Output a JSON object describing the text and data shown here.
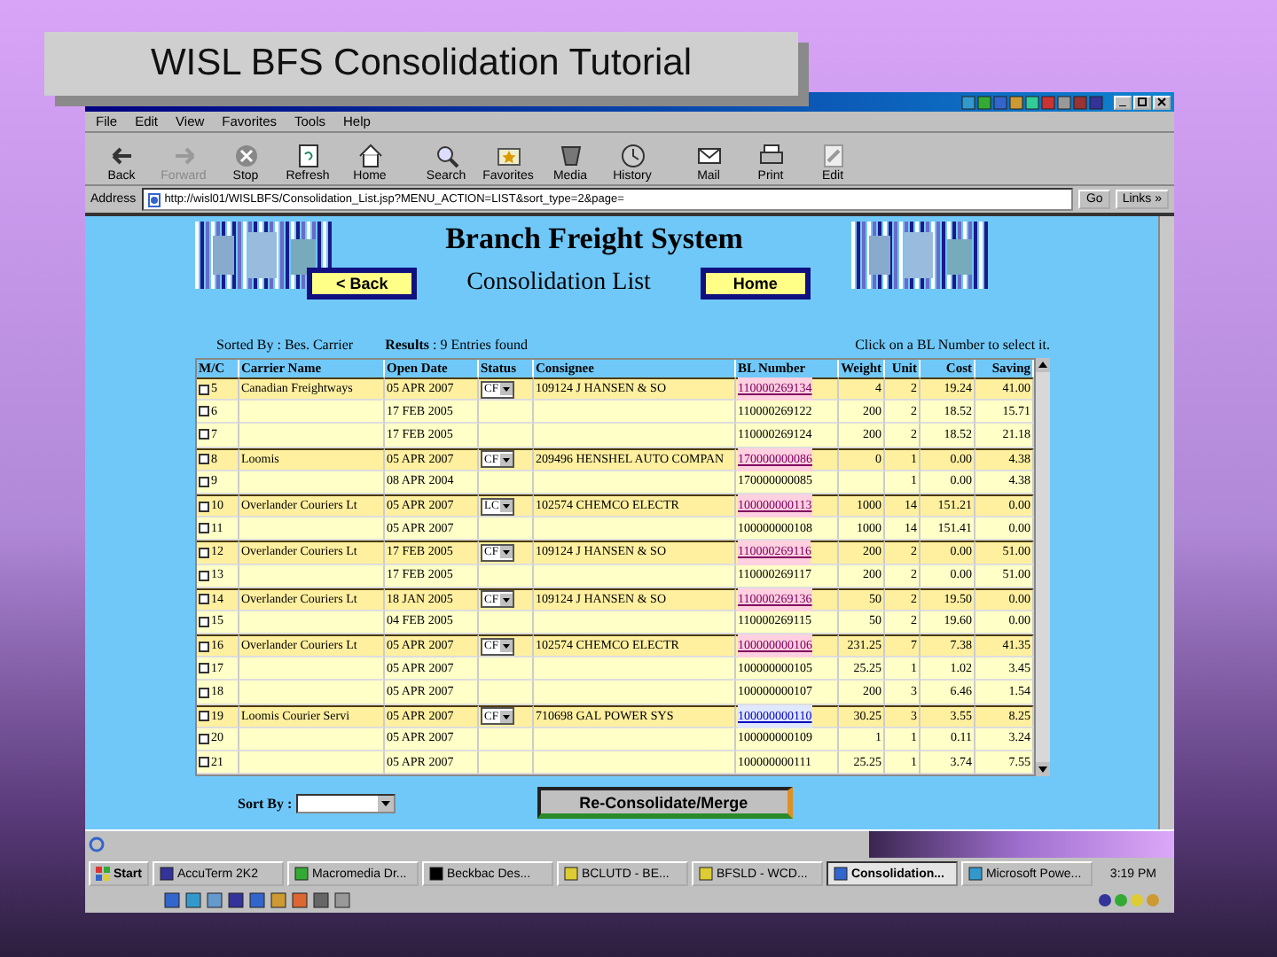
{
  "slide": {
    "title": "WISL BFS Consolidation Tutorial"
  },
  "browser": {
    "menu": [
      "File",
      "Edit",
      "View",
      "Favorites",
      "Tools",
      "Help"
    ],
    "toolbar": [
      {
        "label": "Back",
        "disabled": false
      },
      {
        "label": "Forward",
        "disabled": true
      },
      {
        "label": "Stop",
        "disabled": false
      },
      {
        "label": "Refresh",
        "disabled": false
      },
      {
        "label": "Home",
        "disabled": false
      },
      {
        "label": "Search",
        "disabled": false
      },
      {
        "label": "Favorites",
        "disabled": false
      },
      {
        "label": "Media",
        "disabled": false
      },
      {
        "label": "History",
        "disabled": false
      },
      {
        "label": "Mail",
        "disabled": false
      },
      {
        "label": "Print",
        "disabled": false
      },
      {
        "label": "Edit",
        "disabled": false
      }
    ],
    "address": {
      "label": "Address",
      "value": "http://wisl01/WISLBFS/Consolidation_List.jsp?MENU_ACTION=LIST&sort_type=2&page=",
      "go": "Go",
      "links": "Links »"
    }
  },
  "page": {
    "heading": "Branch Freight System",
    "subheading": "Consolidation List",
    "back_button": "< Back",
    "home_button": "Home",
    "sorted_by": "Sorted By : Bes. Carrier",
    "results": "**Results** : 9 Entries found",
    "hint": "Click on a BL Number to select it.",
    "columns": [
      "M/C",
      "Carrier Name",
      "Open Date",
      "Status",
      "Consignee",
      "BL Number",
      "Weight",
      "Unit",
      "Cost",
      "Saving"
    ],
    "rows": [
      {
        "kind": "master",
        "checked": false,
        "no": "5",
        "carrier": "Canadian Freightways",
        "date": "05 APR 2007",
        "status": "CF",
        "consignee": "109124 J HANSEN & SO",
        "bl": "110000269134",
        "visited": true,
        "weight": "4",
        "unit": "2",
        "cost": "19.24",
        "saving": "41.00"
      },
      {
        "kind": "child",
        "checked": false,
        "no": "6",
        "date": "17 FEB 2005",
        "bl": "110000269122",
        "weight": "200",
        "unit": "2",
        "cost": "18.52",
        "saving": "15.71"
      },
      {
        "kind": "child",
        "checked": false,
        "no": "7",
        "date": "17 FEB 2005",
        "bl": "110000269124",
        "weight": "200",
        "unit": "2",
        "cost": "18.52",
        "saving": "21.18"
      },
      {
        "kind": "master",
        "checked": false,
        "no": "8",
        "carrier": "Loomis",
        "date": "05 APR 2007",
        "status": "CF",
        "consignee": "209496 HENSHEL AUTO COMPAN",
        "bl": "170000000086",
        "visited": true,
        "weight": "0",
        "unit": "1",
        "cost": "0.00",
        "saving": "4.38"
      },
      {
        "kind": "child",
        "checked": false,
        "no": "9",
        "date": "08 APR 2004",
        "bl": "170000000085",
        "weight": "",
        "unit": "1",
        "cost": "0.00",
        "saving": "4.38"
      },
      {
        "kind": "master",
        "checked": false,
        "no": "10",
        "carrier": "Overlander Couriers Lt",
        "date": "05 APR 2007",
        "status": "LC",
        "consignee": "102574 CHEMCO ELECTR",
        "bl": "100000000113",
        "visited": true,
        "weight": "1000",
        "unit": "14",
        "cost": "151.21",
        "saving": "0.00"
      },
      {
        "kind": "child",
        "checked": false,
        "no": "11",
        "date": "05 APR 2007",
        "bl": "100000000108",
        "weight": "1000",
        "unit": "14",
        "cost": "151.41",
        "saving": "0.00"
      },
      {
        "kind": "master",
        "checked": false,
        "no": "12",
        "carrier": "Overlander Couriers Lt",
        "date": "17 FEB 2005",
        "status": "CF",
        "consignee": "109124 J HANSEN & SO",
        "bl": "110000269116",
        "visited": true,
        "weight": "200",
        "unit": "2",
        "cost": "0.00",
        "saving": "51.00"
      },
      {
        "kind": "child",
        "checked": false,
        "no": "13",
        "date": "17 FEB 2005",
        "bl": "110000269117",
        "weight": "200",
        "unit": "2",
        "cost": "0.00",
        "saving": "51.00"
      },
      {
        "kind": "master",
        "checked": false,
        "no": "14",
        "carrier": "Overlander Couriers Lt",
        "date": "18 JAN 2005",
        "status": "CF",
        "consignee": "109124 J HANSEN & SO",
        "bl": "110000269136",
        "visited": true,
        "weight": "50",
        "unit": "2",
        "cost": "19.50",
        "saving": "0.00"
      },
      {
        "kind": "child",
        "checked": false,
        "no": "15",
        "date": "04 FEB 2005",
        "bl": "110000269115",
        "weight": "50",
        "unit": "2",
        "cost": "19.60",
        "saving": "0.00"
      },
      {
        "kind": "master",
        "checked": false,
        "no": "16",
        "carrier": "Overlander Couriers Lt",
        "date": "05 APR 2007",
        "status": "CF",
        "consignee": "102574 CHEMCO ELECTR",
        "bl": "100000000106",
        "visited": true,
        "weight": "231.25",
        "unit": "7",
        "cost": "7.38",
        "saving": "41.35"
      },
      {
        "kind": "child",
        "checked": false,
        "no": "17",
        "date": "05 APR 2007",
        "bl": "100000000105",
        "weight": "25.25",
        "unit": "1",
        "cost": "1.02",
        "saving": "3.45"
      },
      {
        "kind": "child",
        "checked": false,
        "no": "18",
        "date": "05 APR 2007",
        "bl": "100000000107",
        "weight": "200",
        "unit": "3",
        "cost": "6.46",
        "saving": "1.54"
      },
      {
        "kind": "master",
        "checked": false,
        "no": "19",
        "carrier": "Loomis Courier Servi",
        "date": "05 APR 2007",
        "status": "CF",
        "consignee": "710698 GAL POWER SYS",
        "bl": "100000000110",
        "visited": false,
        "weight": "30.25",
        "unit": "3",
        "cost": "3.55",
        "saving": "8.25"
      },
      {
        "kind": "child",
        "checked": false,
        "no": "20",
        "date": "05 APR 2007",
        "bl": "100000000109",
        "weight": "1",
        "unit": "1",
        "cost": "0.11",
        "saving": "3.24"
      },
      {
        "kind": "child",
        "checked": false,
        "no": "21",
        "date": "05 APR 2007",
        "bl": "100000000111",
        "weight": "25.25",
        "unit": "1",
        "cost": "3.74",
        "saving": "7.55"
      }
    ],
    "sort_label": "Sort By :",
    "merge_button": "Re-Consolidate/Merge"
  },
  "taskbar": {
    "start": "Start",
    "items": [
      {
        "label": "AccuTerm 2K2",
        "selected": false
      },
      {
        "label": "Macromedia Dr...",
        "selected": false
      },
      {
        "label": "Beckbac Des...",
        "selected": false
      },
      {
        "label": "BCLUTD - BE...",
        "selected": false
      },
      {
        "label": "BFSLD - WCD...",
        "selected": false
      },
      {
        "label": "Consolidation...",
        "selected": true
      },
      {
        "label": "Microsoft Powe...",
        "selected": false
      }
    ],
    "clock": "3:19 PM"
  }
}
